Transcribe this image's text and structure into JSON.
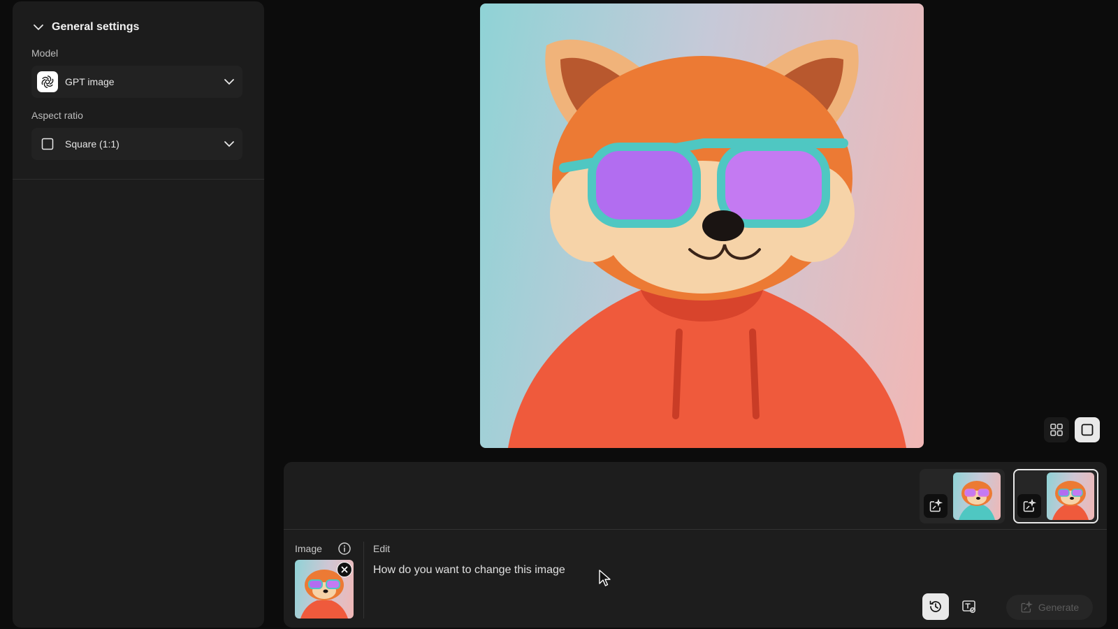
{
  "sidebar": {
    "section_title": "General settings",
    "model_label": "Model",
    "model_value": "GPT image",
    "aspect_label": "Aspect ratio",
    "aspect_value": "Square (1:1)"
  },
  "prompt_panel": {
    "image_label": "Image",
    "edit_label": "Edit",
    "prompt_placeholder": "How do you want to change this image",
    "generate_label": "Generate"
  },
  "icons": {
    "collapse": "chevron-down-icon",
    "model": "openai-logo-icon",
    "aspect": "square-icon",
    "grid_view": "grid-icon",
    "single_view": "single-view-icon",
    "edit_image": "edit-image-icon",
    "info": "info-icon",
    "remove": "close-icon",
    "history": "history-icon",
    "style": "text-style-icon"
  },
  "colors": {
    "background": "#0c0c0c",
    "panel": "#1c1c1c",
    "selected_border": "#e9e9e9",
    "generate_disabled_text": "#5c5c5c"
  }
}
